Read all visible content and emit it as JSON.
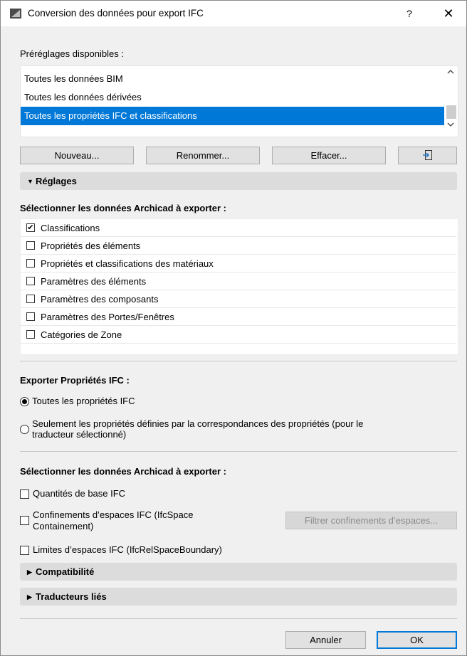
{
  "window": {
    "title": "Conversion des données pour export IFC",
    "help_label": "?",
    "close_label": "✕"
  },
  "presets": {
    "label": "Préréglages disponibles :",
    "items": [
      {
        "label": "Toutes les données BIM",
        "selected": false
      },
      {
        "label": "Toutes les données dérivées",
        "selected": false
      },
      {
        "label": "Toutes les propriétés IFC et classifications",
        "selected": true
      }
    ],
    "scroll_up_icon": "▲",
    "scroll_down_icon": "▼"
  },
  "preset_buttons": {
    "new_label": "Nouveau...",
    "rename_label": "Renommer...",
    "delete_label": "Effacer...",
    "import_icon": "import-icon"
  },
  "reglages": {
    "header": "Réglages",
    "select_label": "Sélectionner les données Archicad à exporter :",
    "items": [
      {
        "label": "Classifications",
        "checked": true
      },
      {
        "label": "Propriétés des éléments",
        "checked": false
      },
      {
        "label": "Propriétés et classifications des matériaux",
        "checked": false
      },
      {
        "label": "Paramètres des éléments",
        "checked": false
      },
      {
        "label": "Paramètres des composants",
        "checked": false
      },
      {
        "label": "Paramètres des Portes/Fenêtres",
        "checked": false
      },
      {
        "label": "Catégories de Zone",
        "checked": false
      }
    ]
  },
  "ifc_properties": {
    "label": "Exporter Propriétés IFC :",
    "option_all": "Toutes les propriétés IFC",
    "option_mapped_line1": "Seulement les propriétés définies par la correspondances des propriétés (pour le",
    "option_mapped_line2": "traducteur sélectionné)",
    "selected": "all"
  },
  "archicad_export": {
    "label": "Sélectionner les données Archicad à exporter :",
    "base_quantities": "Quantités de base IFC",
    "space_containment_line1": "Confinements d’espaces IFC (IfcSpace",
    "space_containment_line2": "Containement)",
    "filter_button": "Filtrer confinements d’espaces...",
    "space_boundaries": "Limites d’espaces IFC (IfcRelSpaceBoundary)"
  },
  "collapsed_sections": {
    "compatibility": "Compatibilité",
    "linked_translators": "Traducteurs liés"
  },
  "footer": {
    "cancel_label": "Annuler",
    "ok_label": "OK"
  },
  "colors": {
    "selection": "#0078d7",
    "window_bg": "#f0f0f0"
  }
}
